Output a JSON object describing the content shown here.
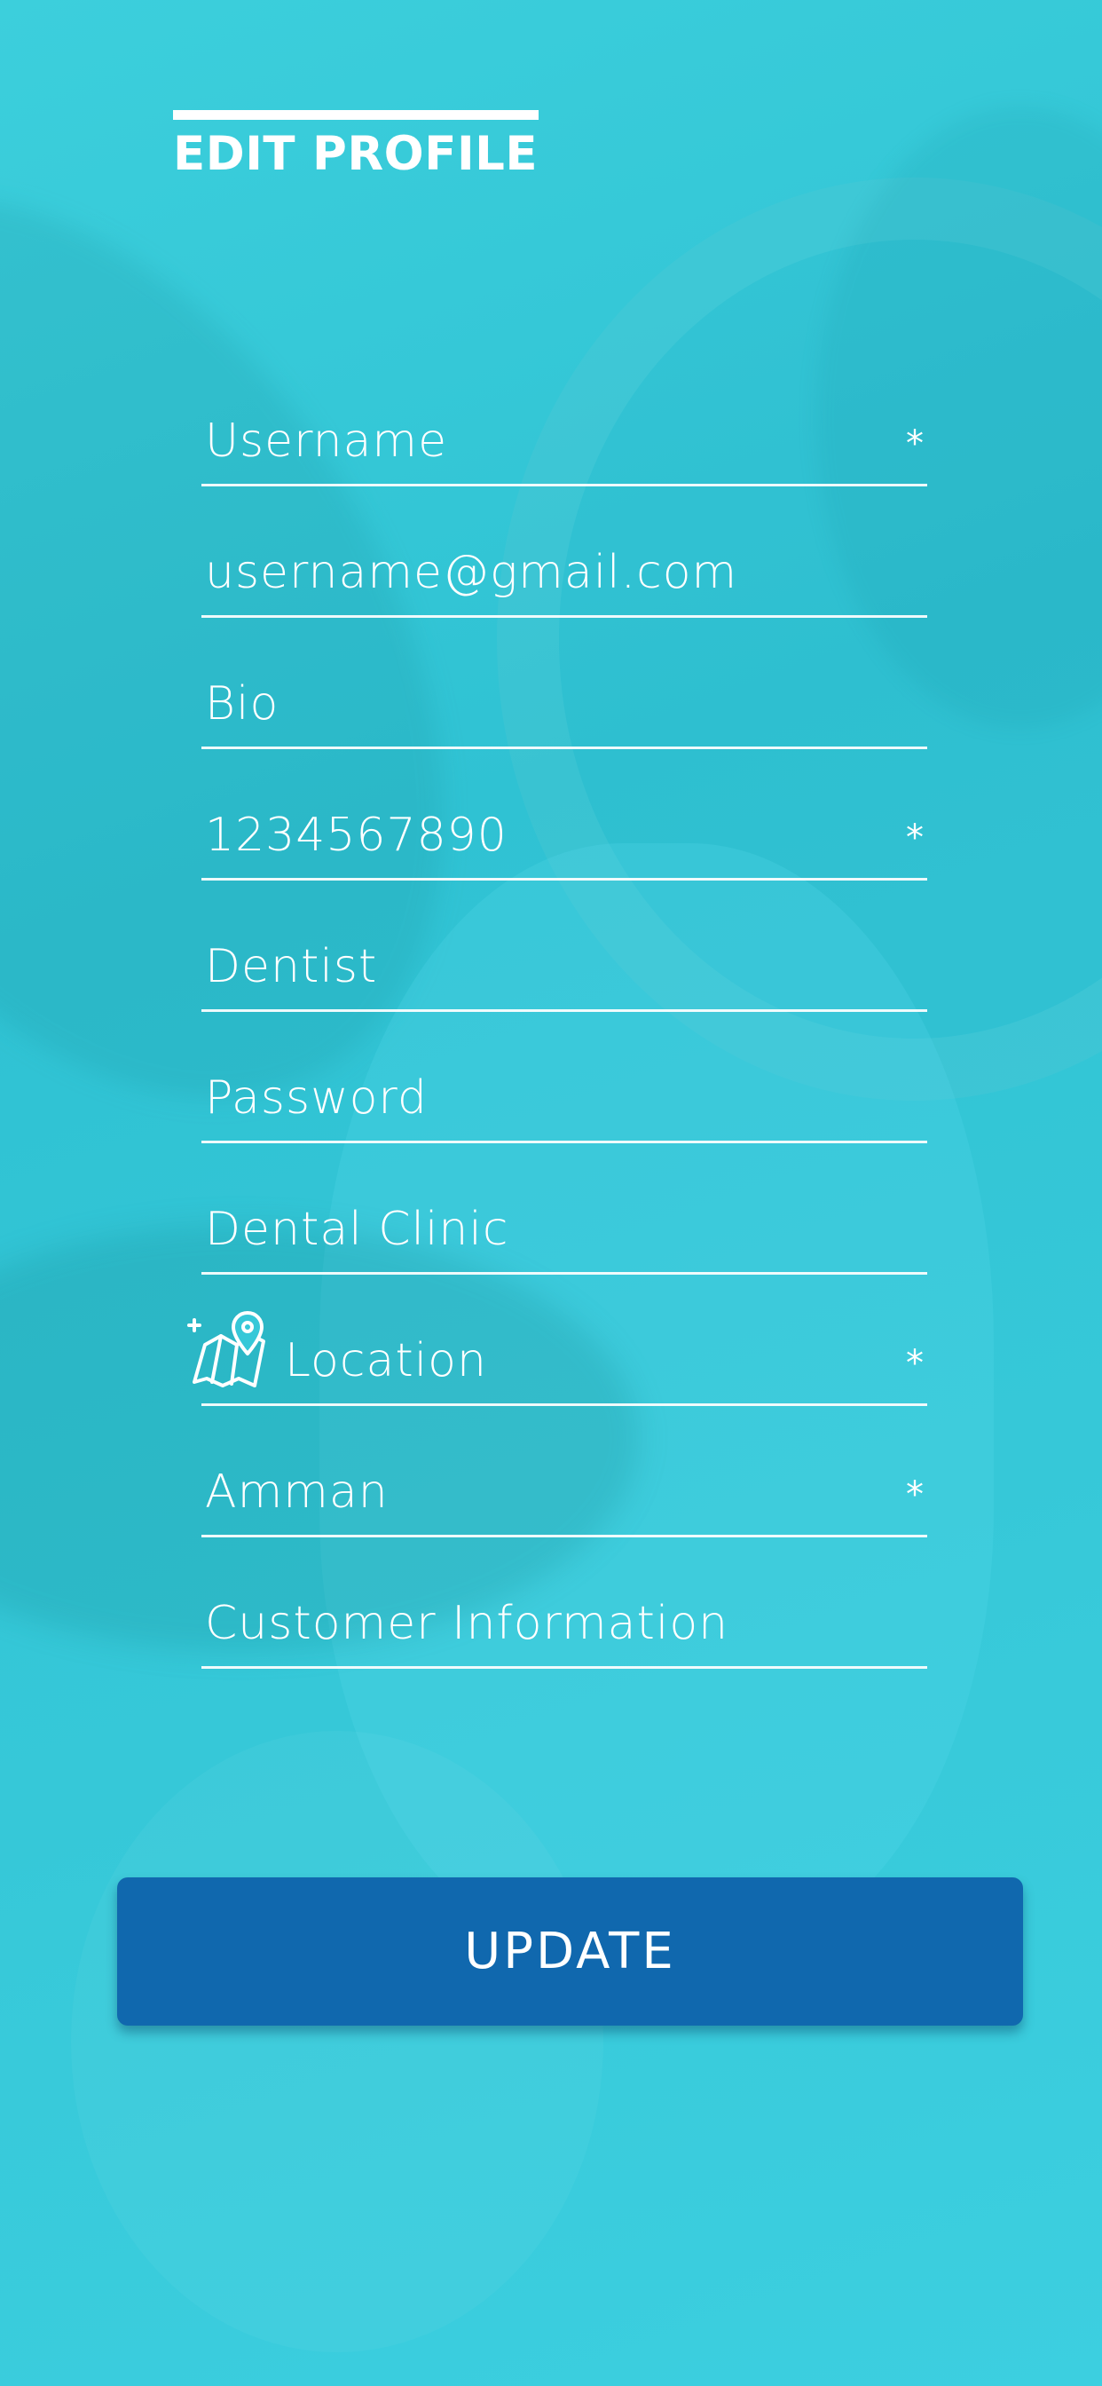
{
  "header": {
    "title": "EDIT PROFILE"
  },
  "form": {
    "fields": [
      {
        "label": "Username",
        "required_mark": "*"
      },
      {
        "label": "username@gmail.com",
        "required_mark": ""
      },
      {
        "label": "Bio",
        "required_mark": ""
      },
      {
        "label": "1234567890",
        "required_mark": "*"
      },
      {
        "label": "Dentist",
        "required_mark": ""
      },
      {
        "label": "Password",
        "required_mark": ""
      },
      {
        "label": "Dental Clinic",
        "required_mark": ""
      },
      {
        "label": "Location",
        "required_mark": "*",
        "icon": "map-pin-add-icon"
      },
      {
        "label": "Amman",
        "required_mark": "*"
      },
      {
        "label": "Customer Information",
        "required_mark": ""
      }
    ]
  },
  "actions": {
    "update_label": "UPDATE"
  },
  "colors": {
    "background": "#36c8d8",
    "button": "#1068ae",
    "text": "#ffffff"
  }
}
